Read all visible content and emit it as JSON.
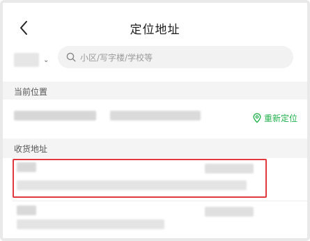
{
  "header": {
    "title": "定位地址",
    "back_icon": "chevron-left-icon"
  },
  "search": {
    "placeholder": "小区/写字楼/学校等",
    "value": "",
    "icon": "search-icon"
  },
  "city_selector": {
    "caret_icon": "chevron-down-icon"
  },
  "current_location": {
    "section_label": "当前位置",
    "relocate_label": "重新定位",
    "relocate_icon": "location-pin-icon",
    "accent_color": "#23b14d"
  },
  "shipping_addresses": {
    "section_label": "收货地址",
    "highlight_color": "#e0393e"
  }
}
